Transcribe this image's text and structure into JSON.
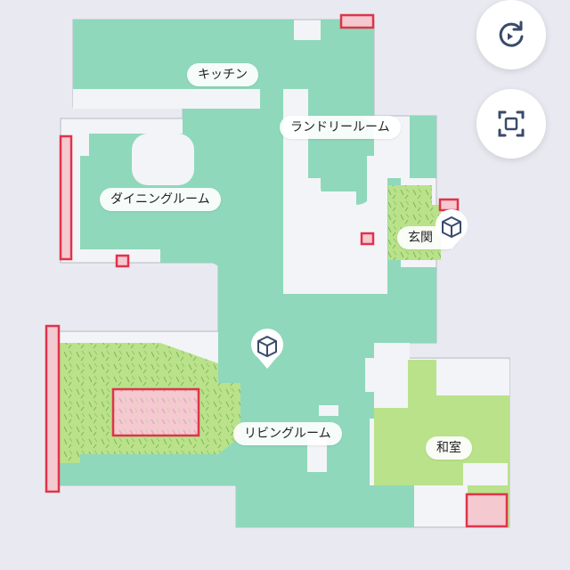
{
  "rooms": {
    "kitchen": "キッチン",
    "laundry": "ランドリールーム",
    "dining": "ダイニングルーム",
    "entrance": "玄関",
    "living": "リビングルーム",
    "washitsu": "和室"
  },
  "controls": {
    "rotate_icon": "rotate-icon",
    "fullscreen_icon": "fullscreen-icon"
  },
  "markers": {
    "icon": "cube-icon"
  },
  "colors": {
    "background": "#e9eaf1",
    "floor": "#f3f4f7",
    "cleaned": "#8fd8bb",
    "carpet": "#b9e28a",
    "no_go_fill": "#f4c9d0",
    "no_go_border": "#e0334b",
    "accent": "#3a4a6b"
  }
}
